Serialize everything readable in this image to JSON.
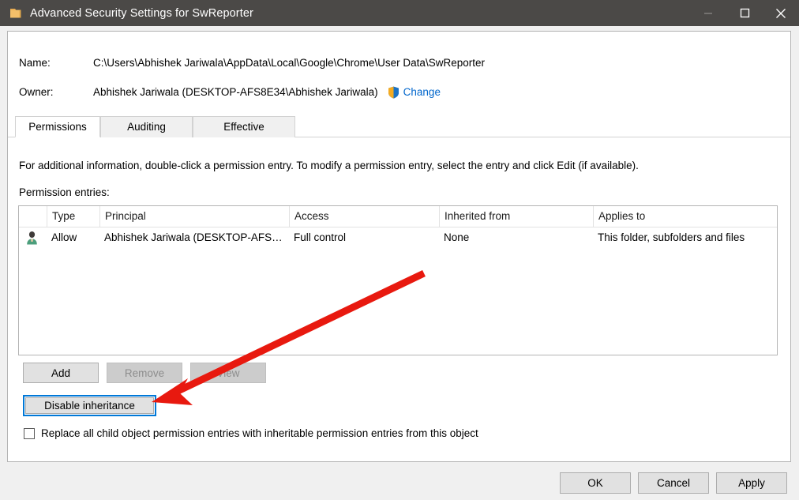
{
  "window": {
    "title": "Advanced Security Settings for SwReporter",
    "icon": "folder-icon",
    "controls": {
      "minimize": "minimize-icon",
      "maximize": "maximize-icon",
      "close": "close-icon"
    }
  },
  "header": {
    "name_label": "Name:",
    "name_value": "C:\\Users\\Abhishek Jariwala\\AppData\\Local\\Google\\Chrome\\User Data\\SwReporter",
    "owner_label": "Owner:",
    "owner_value": "Abhishek Jariwala (DESKTOP-AFS8E34\\Abhishek Jariwala)",
    "change_link": "Change",
    "change_icon": "uac-shield-icon"
  },
  "tabs": [
    {
      "label": "Permissions",
      "active": true
    },
    {
      "label": "Auditing",
      "active": false
    },
    {
      "label": "Effective Access",
      "active": false
    }
  ],
  "main": {
    "info_text": "For additional information, double-click a permission entry. To modify a permission entry, select the entry and click Edit (if available).",
    "entries_label": "Permission entries:",
    "table": {
      "columns": [
        "",
        "Type",
        "Principal",
        "Access",
        "Inherited from",
        "Applies to"
      ],
      "rows": [
        {
          "icon": "user-icon",
          "type": "Allow",
          "principal": "Abhishek Jariwala (DESKTOP-AFS…",
          "access": "Full control",
          "inherited_from": "None",
          "applies_to": "This folder, subfolders and files"
        }
      ]
    },
    "buttons": {
      "add": "Add",
      "remove": "Remove",
      "view": "View",
      "disable_inheritance": "Disable inheritance"
    },
    "button_states": {
      "add": "enabled",
      "remove": "disabled",
      "view": "disabled",
      "disable_inheritance": "focused"
    },
    "checkbox": {
      "label": "Replace all child object permission entries with inheritable permission entries from this object",
      "checked": false
    }
  },
  "footer": {
    "ok": "OK",
    "cancel": "Cancel",
    "apply": "Apply"
  },
  "annotation": {
    "type": "arrow",
    "color": "#e8190f",
    "points_to": "disable-inheritance-button"
  },
  "colors": {
    "titlebar": "#4b4947",
    "window_bg": "#f0f0f0",
    "panel_bg": "#ffffff",
    "link": "#0066cc",
    "focus": "#0078d7",
    "annotation": "#e8190f"
  }
}
